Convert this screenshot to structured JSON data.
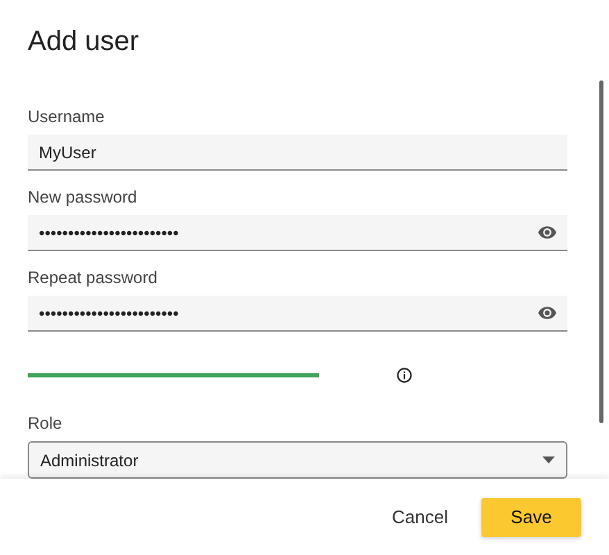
{
  "dialog": {
    "title": "Add user"
  },
  "fields": [
    {
      "kind": "text",
      "label": "Username",
      "value": "MyUser"
    },
    {
      "kind": "password",
      "label": "New password",
      "value": "••••••••••••••••••••••••"
    },
    {
      "kind": "password",
      "label": "Repeat password",
      "value": "••••••••••••••••••••••••"
    }
  ],
  "role": {
    "label": "Role",
    "value": "Administrator"
  },
  "buttons": [
    {
      "kind": "text",
      "label": "Cancel"
    },
    {
      "kind": "primary",
      "label": "Save"
    }
  ]
}
